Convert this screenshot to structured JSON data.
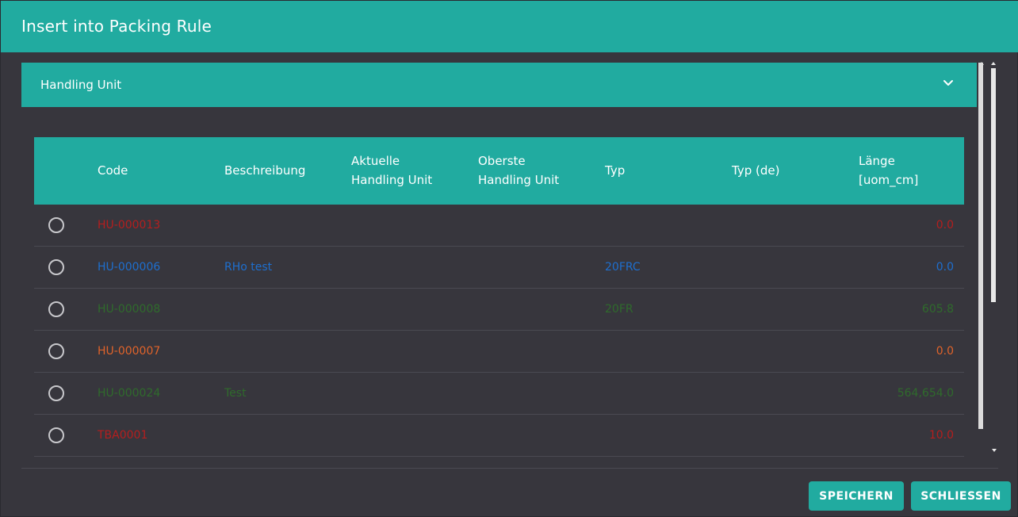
{
  "dialog": {
    "title": "Insert into Packing Rule",
    "panel_title": "Handling Unit",
    "header_color": "#21aba0"
  },
  "table": {
    "headers": {
      "code": "Code",
      "beschreibung": "Beschreibung",
      "aktuelle_1": "Aktuelle",
      "aktuelle_2": "Handling Unit",
      "oberste_1": "Oberste",
      "oberste_2": "Handling Unit",
      "typ": "Typ",
      "typ_de": "Typ (de)",
      "laenge_1": "Länge",
      "laenge_2": "[uom_cm]"
    },
    "rows": [
      {
        "code": "HU-000013",
        "beschreibung": "",
        "typ": "",
        "laenge": "0.0",
        "color": "#b51e1e"
      },
      {
        "code": "HU-000006",
        "beschreibung": "RHo test",
        "typ": "20FRC",
        "laenge": "0.0",
        "color": "#1e6fcf"
      },
      {
        "code": "HU-000008",
        "beschreibung": "",
        "typ": "20FR",
        "laenge": "605.8",
        "color": "#2f6b2c"
      },
      {
        "code": "HU-000007",
        "beschreibung": "",
        "typ": "",
        "laenge": "0.0",
        "color": "#e0632a"
      },
      {
        "code": "HU-000024",
        "beschreibung": "Test",
        "typ": "",
        "laenge": "564,654.0",
        "color": "#2f6b2c"
      },
      {
        "code": "TBA0001",
        "beschreibung": "",
        "typ": "",
        "laenge": "10.0",
        "color": "#b51e1e"
      }
    ]
  },
  "buttons": {
    "save": "SPEICHERN",
    "close": "SCHLIESSEN"
  },
  "icons": {
    "expand": "chevron-down-icon",
    "radio": "radio-unselected-icon"
  }
}
